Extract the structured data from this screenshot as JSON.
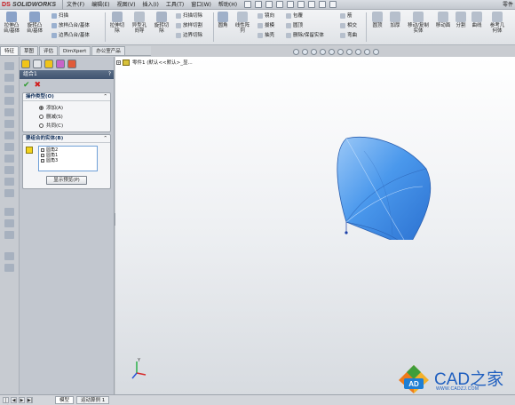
{
  "app": {
    "logo_brand": "DS",
    "logo_text": "SOLIDWORKS",
    "document_title": "零件"
  },
  "menu": [
    "文件(F)",
    "编辑(E)",
    "视图(V)",
    "插入(I)",
    "工具(T)",
    "窗口(W)",
    "帮助(H)"
  ],
  "ribbon": {
    "large_buttons": [
      {
        "label": "拉伸凸\n台/基体",
        "icon": "extruded-boss-icon",
        "color": "#8aa2c8"
      },
      {
        "label": "旋转凸\n台/基体",
        "icon": "revolved-boss-icon",
        "color": "#8aa2c8"
      },
      {
        "label": "拉伸切\n除",
        "icon": "extruded-cut-icon",
        "color": "#a8b4c6"
      },
      {
        "label": "异型孔\n向导",
        "icon": "hole-wizard-icon",
        "color": "#b7c0cc"
      },
      {
        "label": "旋转切\n除",
        "icon": "revolved-cut-icon",
        "color": "#a8b4c6"
      },
      {
        "label": "圆角",
        "icon": "fillet-icon",
        "color": "#9fb0c9"
      },
      {
        "label": "线性阵\n列",
        "icon": "linear-pattern-icon",
        "color": "#b8c2cf"
      },
      {
        "label": "筋",
        "icon": "rib-icon",
        "color": "#b6bfcc"
      },
      {
        "label": "包覆",
        "icon": "wrap-icon",
        "color": "#b6bfcc"
      },
      {
        "label": "拔模",
        "icon": "draft-icon",
        "color": "#b6bfcc"
      },
      {
        "label": "抽壳",
        "icon": "shell-icon",
        "color": "#b6bfcc"
      },
      {
        "label": "镜向",
        "icon": "mirror-icon",
        "color": "#b6bfcc"
      },
      {
        "label": "相交",
        "icon": "intersect-icon",
        "color": "#b6bfcc"
      },
      {
        "label": "圆顶",
        "icon": "dome-icon",
        "color": "#b6bfcc"
      },
      {
        "label": "参考几\n何体",
        "icon": "reference-geometry-icon",
        "color": "#b6bfcc"
      },
      {
        "label": "曲线",
        "icon": "curves-icon",
        "color": "#b6bfcc"
      }
    ],
    "small_items": [
      {
        "label": "扫描",
        "icon": "sweep-icon"
      },
      {
        "label": "放样凸台/基体",
        "icon": "loft-boss-icon"
      },
      {
        "label": "边界凸台/基体",
        "icon": "boundary-boss-icon"
      },
      {
        "label": "扫描切除",
        "icon": "swept-cut-icon"
      },
      {
        "label": "放样切割",
        "icon": "lofted-cut-icon"
      },
      {
        "label": "边界切除",
        "icon": "boundary-cut-icon"
      },
      {
        "label": "镜向",
        "icon": "mirror-small-icon"
      },
      {
        "label": "拔模",
        "icon": "draft-small-icon"
      },
      {
        "label": "抽壳",
        "icon": "shell-small-icon"
      },
      {
        "label": "包覆",
        "icon": "wrap-small-icon"
      },
      {
        "label": "圆顶",
        "icon": "dome-small-icon"
      },
      {
        "label": "删除/保留实体",
        "icon": "delete-body-icon"
      },
      {
        "label": "筋",
        "icon": "rib-small-icon"
      },
      {
        "label": "相交",
        "icon": "intersect-small-icon"
      },
      {
        "label": "弯曲",
        "icon": "flex-icon"
      },
      {
        "label": "移动/复制实体",
        "icon": "move-copy-body-icon"
      },
      {
        "label": "移动面",
        "icon": "move-face-icon"
      },
      {
        "label": "分割",
        "icon": "split-icon"
      },
      {
        "label": "加厚",
        "icon": "thicken-icon"
      },
      {
        "label": "组合",
        "icon": "combine-icon"
      }
    ]
  },
  "tabs": [
    "特征",
    "草图",
    "评估",
    "DimXpert",
    "办公室产品"
  ],
  "property_manager": {
    "title": "组合1",
    "help": "?",
    "ok_symbol": "✔",
    "cancel_symbol": "✖",
    "operation_group": {
      "title": "操作类型(O)",
      "options": [
        {
          "label": "添加(A)",
          "selected": true
        },
        {
          "label": "删减(S)",
          "selected": false
        },
        {
          "label": "共同(C)",
          "selected": false
        }
      ]
    },
    "bodies_group": {
      "title": "要组合的实体(B)",
      "bodies": [
        "圆角2",
        "圆角1",
        "圆角3"
      ],
      "preview_button": "显示预览(P)"
    },
    "collapse_symbol": "⌃"
  },
  "tree": {
    "expand": "+",
    "label": "零件1 (默认<<默认>_显..."
  },
  "triad": {
    "x": "X",
    "y": "Y",
    "z": "Z"
  },
  "watermark": {
    "text": "CAD之家",
    "url": "WWW.CADZJ.COM",
    "badge": "AD"
  },
  "bottom_tabs": [
    "模型",
    "运动算例 1"
  ],
  "colors": {
    "shape_fill": "#3f8ee8",
    "shape_light": "#8cc0f5",
    "shape_edge": "#2a5fb0",
    "accent": "#1f5fbf"
  }
}
